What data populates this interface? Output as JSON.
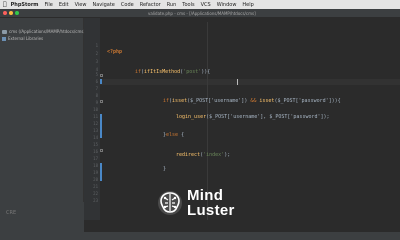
{
  "menubar": {
    "apple_icon": "apple-icon",
    "app_name": "PhpStorm",
    "items": [
      "File",
      "Edit",
      "View",
      "Navigate",
      "Code",
      "Refactor",
      "Run",
      "Tools",
      "VCS",
      "Window",
      "Help"
    ]
  },
  "window": {
    "title": "validate.php - cms - [/Applications/MAMP/htdocs/cms]",
    "traffic_lights": [
      "#fc605c",
      "#fdbc40",
      "#34c84a"
    ]
  },
  "project_panel": {
    "items": [
      {
        "label": "cms (/Applications/MAMP/htdocs/cms)",
        "icon": "folder-icon"
      },
      {
        "label": "External Libraries",
        "icon": "library-icon"
      }
    ],
    "bottom_label": "CRE"
  },
  "editor": {
    "line_numbers": [
      "1",
      "2",
      "3",
      "4",
      "5",
      "6",
      "7",
      "8",
      "9",
      "10",
      "11",
      "12",
      "13",
      "14",
      "15",
      "16",
      "17",
      "18",
      "19",
      "20",
      "21",
      "22",
      "23"
    ],
    "code": {
      "php_open": "<?php",
      "if_kw": "if",
      "if_fn": "ifItIsMethod",
      "if_str": "'post'",
      "inner_if": "if",
      "isset": "isset",
      "post_user": "$_POST['username']",
      "and": "&&",
      "post_pass": "$_POST['password']",
      "login_fn": "login_user",
      "login_args": "($_POST['username'], $_POST['password']);",
      "else_kw": "else",
      "redirect_fn": "redirect",
      "redirect_str": "'index'",
      "close_brace": "}"
    }
  },
  "watermark": {
    "line1": "Mind",
    "line2": "Luster",
    "icon": "brain-icon"
  },
  "colors": {
    "keyword": "#cc7832",
    "function": "#ffc66d",
    "string": "#6a8759",
    "plain": "#a9b7c6",
    "editor_bg": "#2b2b2b"
  }
}
